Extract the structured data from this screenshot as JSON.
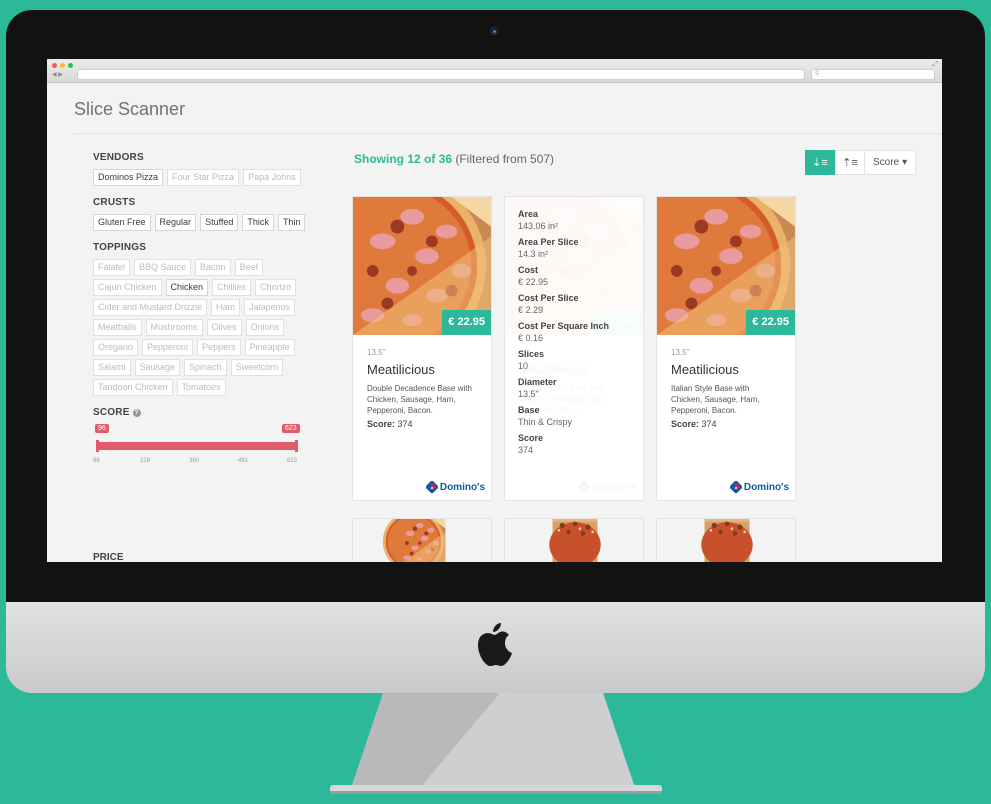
{
  "app": {
    "title": "Slice Scanner"
  },
  "browser": {
    "search_placeholder": ""
  },
  "sidebar": {
    "vendors": {
      "heading": "VENDORS",
      "items": [
        {
          "label": "Dominos Pizza",
          "active": true
        },
        {
          "label": "Four Star Pizza",
          "active": false
        },
        {
          "label": "Papa Johns",
          "active": false
        }
      ]
    },
    "crusts": {
      "heading": "CRUSTS",
      "items": [
        {
          "label": "Gluten Free",
          "active": true
        },
        {
          "label": "Regular",
          "active": true
        },
        {
          "label": "Stuffed",
          "active": true
        },
        {
          "label": "Thick",
          "active": true
        },
        {
          "label": "Thin",
          "active": true
        }
      ]
    },
    "toppings": {
      "heading": "TOPPINGS",
      "items": [
        {
          "label": "Falafel",
          "active": false
        },
        {
          "label": "BBQ Sauce",
          "active": false
        },
        {
          "label": "Bacon",
          "active": false
        },
        {
          "label": "Beef",
          "active": false
        },
        {
          "label": "Cajun Chicken",
          "active": false
        },
        {
          "label": "Chicken",
          "active": true
        },
        {
          "label": "Chillies",
          "active": false
        },
        {
          "label": "Chorizo",
          "active": false
        },
        {
          "label": "Cider and Mustard Drizzle",
          "active": false
        },
        {
          "label": "Ham",
          "active": false
        },
        {
          "label": "Jalapenos",
          "active": false
        },
        {
          "label": "Meatballs",
          "active": false
        },
        {
          "label": "Mushrooms",
          "active": false
        },
        {
          "label": "Olives",
          "active": false
        },
        {
          "label": "Onions",
          "active": false
        },
        {
          "label": "Oregano",
          "active": false
        },
        {
          "label": "Pepperoni",
          "active": false
        },
        {
          "label": "Peppers",
          "active": false
        },
        {
          "label": "Pineapple",
          "active": false
        },
        {
          "label": "Salami",
          "active": false
        },
        {
          "label": "Sausage",
          "active": false
        },
        {
          "label": "Spinach",
          "active": false
        },
        {
          "label": "Sweetcorn",
          "active": false
        },
        {
          "label": "Tandoori Chicken",
          "active": false
        },
        {
          "label": "Tomatoes",
          "active": false
        }
      ]
    },
    "score": {
      "heading": "SCORE",
      "min_label": "96",
      "max_label": "623",
      "ticks": [
        "96",
        "228",
        "360",
        "491",
        "623"
      ]
    },
    "price": {
      "heading": "PRICE"
    }
  },
  "results": {
    "showing_count": "Showing 12 of 36",
    "filtered_text": "(Filtered from 507)",
    "sort_label": "Score"
  },
  "cards": [
    {
      "price": "€ 22.95",
      "size": "13.5\"",
      "name": "Meatilicious",
      "description": "Double Decadence Base with Chicken, Sausage, Ham, Pepperoni, Bacon.",
      "score_label": "Score:",
      "score": "374",
      "vendor": "Domino's"
    },
    {
      "price": "€ 22.95",
      "size": "13.5\"",
      "name": "Meatilicious",
      "description": "Thin & Crispy Base with Chicken, Sausage, Ham, Pepperoni, Bacon.",
      "score_label": "Score:",
      "score": "374",
      "vendor": "Domino's",
      "details": [
        {
          "label": "Area",
          "value": "143.06 in²"
        },
        {
          "label": "Area Per Slice",
          "value": "14.3 in²"
        },
        {
          "label": "Cost",
          "value": "€ 22.95"
        },
        {
          "label": "Cost Per Slice",
          "value": "€ 2.29"
        },
        {
          "label": "Cost Per Square Inch",
          "value": "€ 0.16"
        },
        {
          "label": "Slices",
          "value": "10"
        },
        {
          "label": "Diameter",
          "value": "13.5\""
        },
        {
          "label": "Base",
          "value": "Thin & Crispy"
        },
        {
          "label": "Score",
          "value": "374"
        }
      ]
    },
    {
      "price": "€ 22.95",
      "size": "13.5\"",
      "name": "Meatilicious",
      "description": "Italian Style Base with Chicken, Sausage, Ham, Pepperoni, Bacon.",
      "score_label": "Score:",
      "score": "374",
      "vendor": "Domino's"
    }
  ],
  "colors": {
    "accent": "#2bb99a",
    "slider": "#e05b6b",
    "background": "#2bb99a",
    "vendor_blue": "#0b5ea8"
  }
}
